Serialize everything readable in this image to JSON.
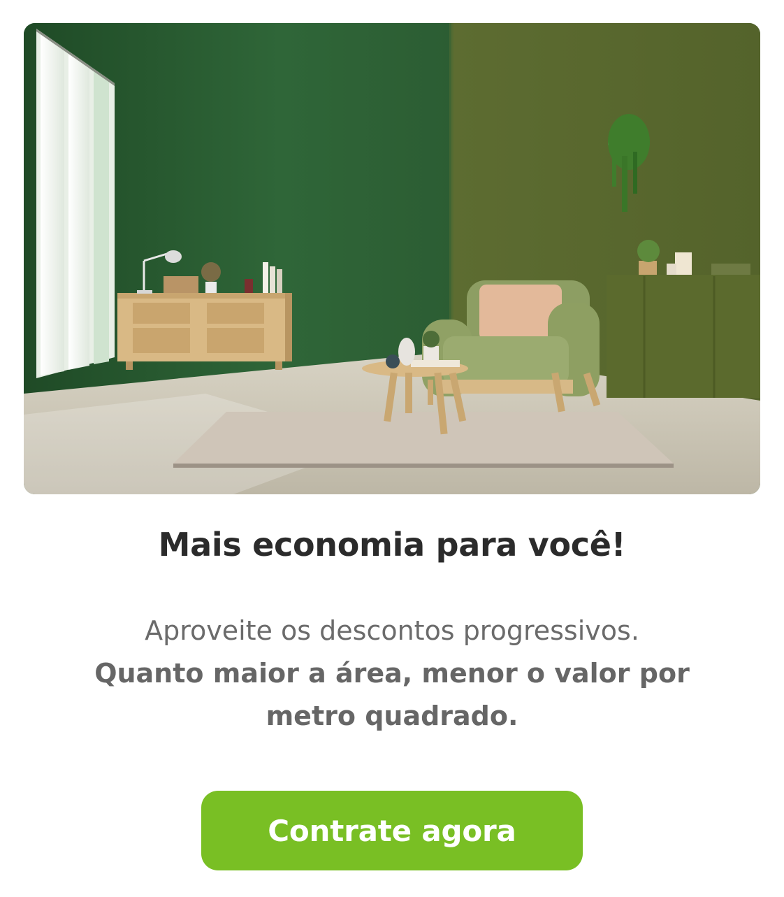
{
  "promo": {
    "title": "Mais economia para você!",
    "description_regular": "Aproveite os descontos progressivos.",
    "description_bold": "Quanto maior a área, menor o valor por metro quadrado.",
    "cta_label": "Contrate agora"
  },
  "colors": {
    "cta_background": "#79bf24",
    "title_text": "#2b2b2b",
    "body_text": "#6b6b6b",
    "wall_dark_green": "#2f5f35",
    "wall_olive_green": "#5b6b2f"
  }
}
